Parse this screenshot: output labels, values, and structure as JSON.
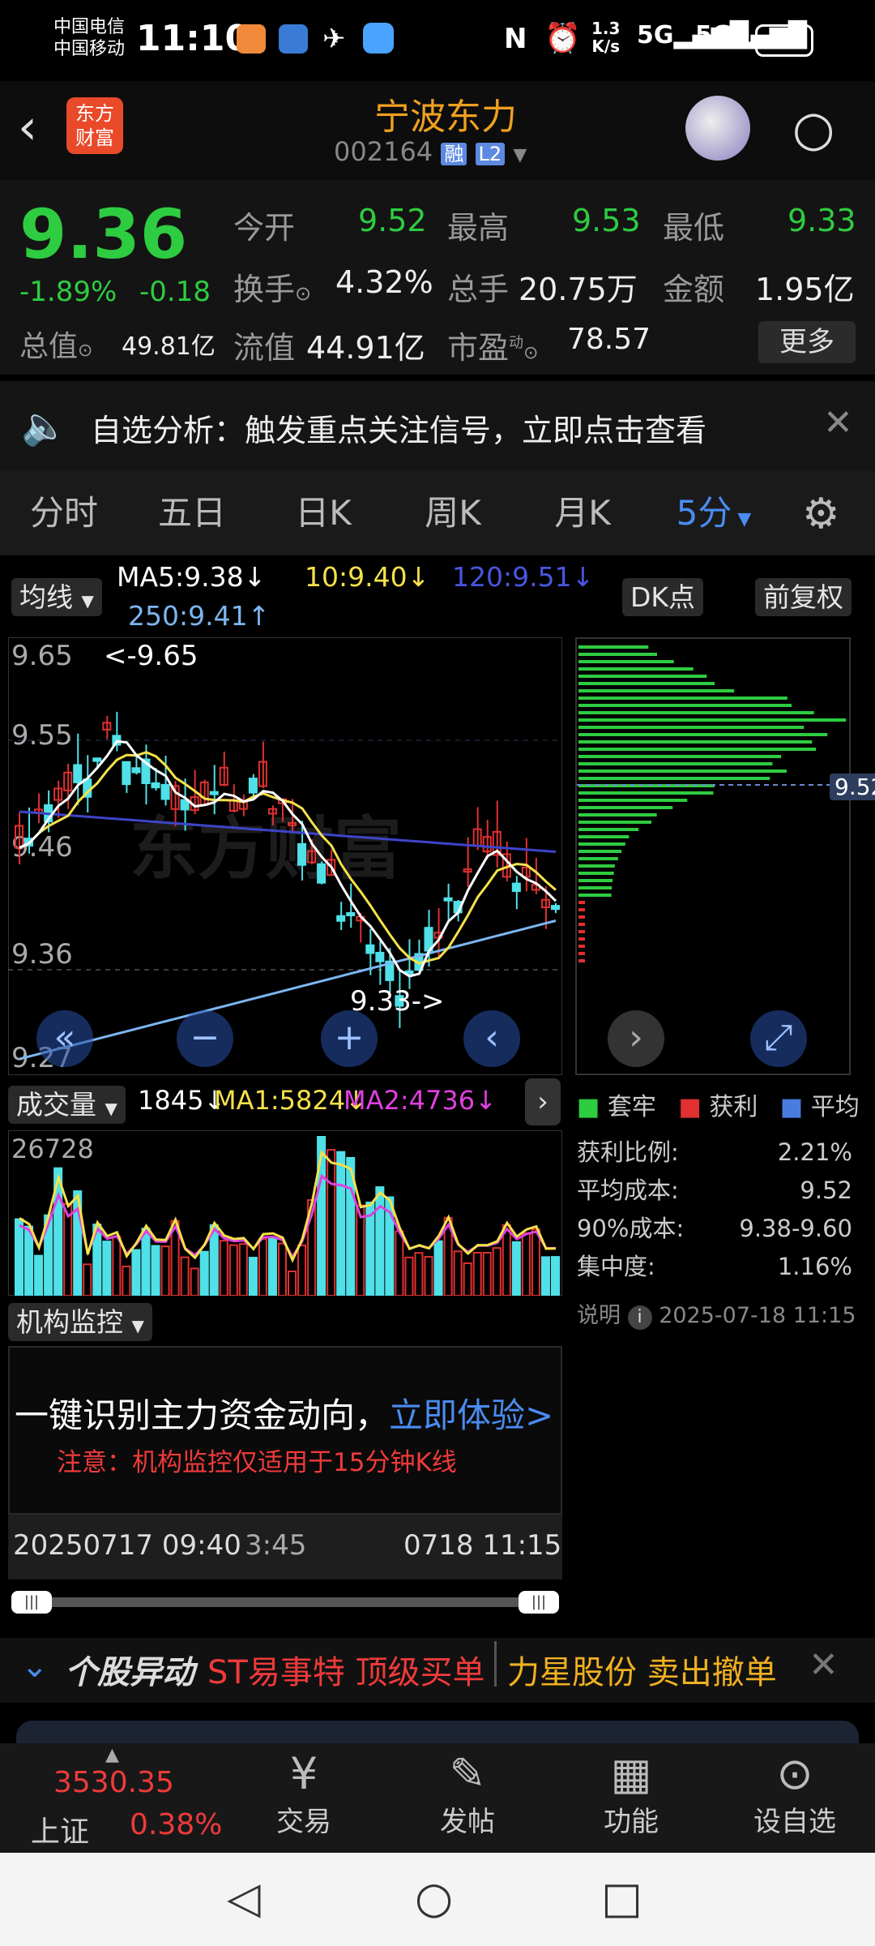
{
  "status": {
    "carrier1": "中国电信",
    "carrier2": "中国移动",
    "time": "11:10",
    "net_speed": "1.3",
    "net_unit": "K/s",
    "battery": "40"
  },
  "header": {
    "logo_line1": "东方",
    "logo_line2": "财富",
    "stock_name": "宁波东力",
    "stock_code": "002164",
    "badge_rong": "融",
    "badge_l2": "L2"
  },
  "quote": {
    "price": "9.36",
    "change_pct": "-1.89%",
    "change": "-0.18",
    "open_label": "今开",
    "open": "9.52",
    "high_label": "最高",
    "high": "9.53",
    "low_label": "最低",
    "low": "9.33",
    "turnover_label": "换手",
    "turnover": "4.32%",
    "volume_label": "总手",
    "volume": "20.75万",
    "amount_label": "金额",
    "amount": "1.95亿",
    "mktcap_label": "总值",
    "mktcap": "49.81亿",
    "float_label": "流值",
    "float": "44.91亿",
    "pe_label": "市盈",
    "pe_sup": "动",
    "pe": "78.57",
    "more_label": "更多"
  },
  "alert": {
    "text": "自选分析：触发重点关注信号，立即点击查看"
  },
  "tabs": [
    "分时",
    "五日",
    "日K",
    "周K",
    "月K",
    "5分"
  ],
  "chart": {
    "indicator_label": "均线",
    "ma5": "MA5:9.38",
    "ma10": "10:9.40",
    "ma120": "120:9.51",
    "ma250": "250:9.41",
    "dk_label": "DK点",
    "fq_label": "前复权",
    "y_labels": [
      "9.65",
      "9.55",
      "9.46",
      "9.36",
      "9.27"
    ],
    "max_label": "<-9.65",
    "min_label": "9.33->",
    "watermark": "东方财富",
    "cost_price_tag": "9.52"
  },
  "chart_data": {
    "type": "candlestick",
    "ylim": [
      9.27,
      9.65
    ],
    "high": 9.65,
    "low": 9.33,
    "close": 9.36,
    "ma": [
      {
        "name": "MA5",
        "value": 9.38
      },
      {
        "name": "MA10",
        "value": 9.4
      },
      {
        "name": "MA120",
        "value": 9.51
      },
      {
        "name": "MA250",
        "value": 9.41
      }
    ]
  },
  "volume": {
    "label": "成交量",
    "value": "1845",
    "ma1": "MA1:5824",
    "ma2": "MA2:4736",
    "max_label": "26728"
  },
  "cost": {
    "legend_hold": "套牢",
    "legend_profit": "获利",
    "legend_avg": "平均",
    "rows": [
      {
        "k": "获利比例:",
        "v": "2.21%"
      },
      {
        "k": "平均成本:",
        "v": "9.52"
      },
      {
        "k": "90%成本:",
        "v": "9.38-9.60"
      },
      {
        "k": "集中度:",
        "v": "1.16%"
      }
    ],
    "note_label": "说明",
    "note_time": "2025-07-18 11:15"
  },
  "institution": {
    "label": "机构监控",
    "headline": "一键识别主力资金动向，",
    "cta": "立即体验>",
    "notice": "注意：机构监控仅适用于15分钟K线"
  },
  "timeline": {
    "start": "20250717 09:40",
    "mid": "3:45",
    "end": "0718 11:15"
  },
  "ticker": {
    "title": "个股异动",
    "item1_name": "ST易事特",
    "item1_action": "顶级买单",
    "item2_name": "力星股份",
    "item2_action": "卖出撤单"
  },
  "bottom": {
    "index_value": "3530.35",
    "index_name": "上证",
    "index_pct": "0.38%",
    "trade": "交易",
    "post": "发帖",
    "func": "功能",
    "watch": "设自选"
  }
}
